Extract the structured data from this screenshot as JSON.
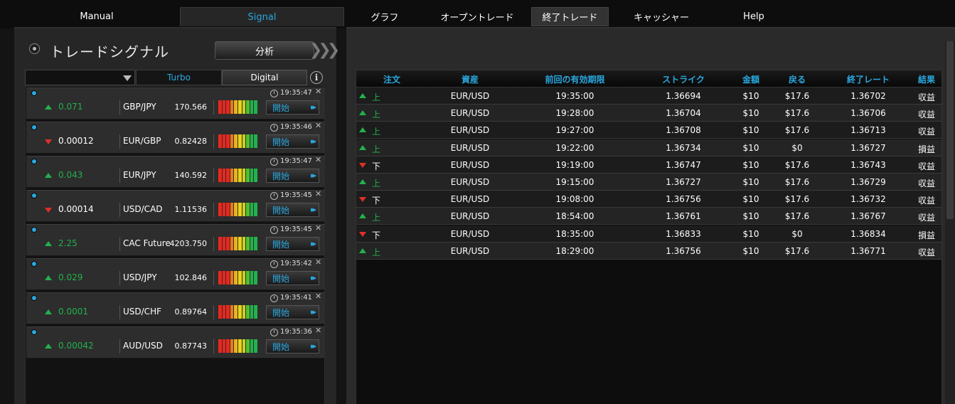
{
  "nav": {
    "tabs": [
      {
        "label": "Manual"
      },
      {
        "label": "Signal"
      },
      {
        "label": "グラフ"
      },
      {
        "label": "オープントレード"
      },
      {
        "label": "終了トレード"
      },
      {
        "label": "キャッシャー"
      },
      {
        "label": "Help"
      }
    ]
  },
  "signal_panel": {
    "title": "トレードシグナル",
    "analyze_label": "分析",
    "filter": {
      "dropdown_value": "",
      "turbo_label": "Turbo",
      "digital_label": "Digital",
      "info_label": "i"
    },
    "start_label": "開始",
    "signals": [
      {
        "direction": "up",
        "value": "0.071",
        "pair": "GBP/JPY",
        "price": "170.566",
        "time": "19:35:47"
      },
      {
        "direction": "down",
        "value": "0.00012",
        "pair": "EUR/GBP",
        "price": "0.82428",
        "time": "19:35:46"
      },
      {
        "direction": "up",
        "value": "0.043",
        "pair": "EUR/JPY",
        "price": "140.592",
        "time": "19:35:47"
      },
      {
        "direction": "down",
        "value": "0.00014",
        "pair": "USD/CAD",
        "price": "1.11536",
        "time": "19:35:45"
      },
      {
        "direction": "up",
        "value": "2.25",
        "pair": "CAC Future",
        "price": "4203.750",
        "time": "19:35:45"
      },
      {
        "direction": "up",
        "value": "0.029",
        "pair": "USD/JPY",
        "price": "102.846",
        "time": "19:35:42"
      },
      {
        "direction": "up",
        "value": "0.0001",
        "pair": "USD/CHF",
        "price": "0.89764",
        "time": "19:35:41"
      },
      {
        "direction": "up",
        "value": "0.00042",
        "pair": "AUD/USD",
        "price": "0.87743",
        "time": "19:35:36"
      }
    ],
    "meter_colors": [
      "#e8281e",
      "#e8281e",
      "#e8281e",
      "#e87a1e",
      "#e8b41e",
      "#e8d21e",
      "#c8d21e",
      "#4ebf32",
      "#22b14c",
      "#22b14c"
    ]
  },
  "closed_trades": {
    "headers": [
      "注文",
      "資産",
      "前回の有効期限",
      "ストライク",
      "金額",
      "戻る",
      "終了レート",
      "結果"
    ],
    "rows": [
      {
        "direction": "up",
        "order": "上",
        "asset": "EUR/USD",
        "expiry": "19:35:00",
        "strike": "1.36694",
        "amount": "$10",
        "return": "$17.6",
        "close_rate": "1.36702",
        "result": "収益"
      },
      {
        "direction": "up",
        "order": "上",
        "asset": "EUR/USD",
        "expiry": "19:28:00",
        "strike": "1.36704",
        "amount": "$10",
        "return": "$17.6",
        "close_rate": "1.36706",
        "result": "収益"
      },
      {
        "direction": "up",
        "order": "上",
        "asset": "EUR/USD",
        "expiry": "19:27:00",
        "strike": "1.36708",
        "amount": "$10",
        "return": "$17.6",
        "close_rate": "1.36713",
        "result": "収益"
      },
      {
        "direction": "up",
        "order": "上",
        "asset": "EUR/USD",
        "expiry": "19:22:00",
        "strike": "1.36734",
        "amount": "$10",
        "return": "$0",
        "close_rate": "1.36727",
        "result": "損益"
      },
      {
        "direction": "down",
        "order": "下",
        "asset": "EUR/USD",
        "expiry": "19:19:00",
        "strike": "1.36747",
        "amount": "$10",
        "return": "$17.6",
        "close_rate": "1.36743",
        "result": "収益"
      },
      {
        "direction": "up",
        "order": "上",
        "asset": "EUR/USD",
        "expiry": "19:15:00",
        "strike": "1.36727",
        "amount": "$10",
        "return": "$17.6",
        "close_rate": "1.36729",
        "result": "収益"
      },
      {
        "direction": "down",
        "order": "下",
        "asset": "EUR/USD",
        "expiry": "19:08:00",
        "strike": "1.36756",
        "amount": "$10",
        "return": "$17.6",
        "close_rate": "1.36732",
        "result": "収益"
      },
      {
        "direction": "up",
        "order": "上",
        "asset": "EUR/USD",
        "expiry": "18:54:00",
        "strike": "1.36761",
        "amount": "$10",
        "return": "$17.6",
        "close_rate": "1.36767",
        "result": "収益"
      },
      {
        "direction": "down",
        "order": "下",
        "asset": "EUR/USD",
        "expiry": "18:35:00",
        "strike": "1.36833",
        "amount": "$10",
        "return": "$0",
        "close_rate": "1.36834",
        "result": "損益"
      },
      {
        "direction": "up",
        "order": "上",
        "asset": "EUR/USD",
        "expiry": "18:29:00",
        "strike": "1.36756",
        "amount": "$10",
        "return": "$17.6",
        "close_rate": "1.36771",
        "result": "収益"
      }
    ]
  },
  "colors": {
    "accent_blue": "#29a8e0",
    "up_green": "#22b14c",
    "down_red": "#e0302a"
  }
}
